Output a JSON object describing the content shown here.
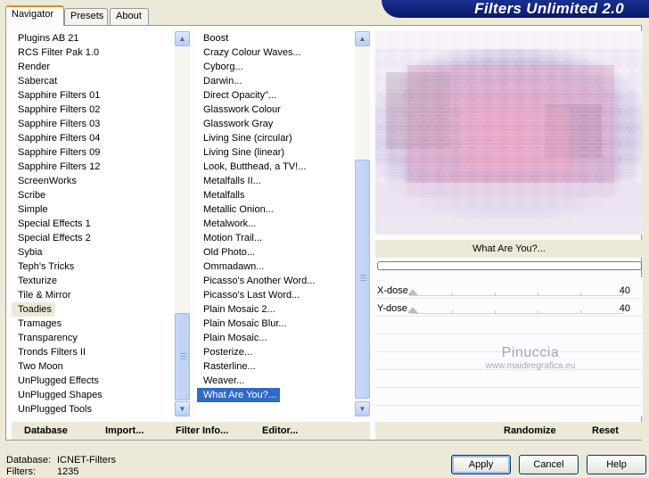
{
  "tabs": [
    "Navigator",
    "Presets",
    "About"
  ],
  "app_title": "Filters Unlimited 2.0",
  "categories": {
    "items": [
      "Plugins AB 21",
      "RCS Filter Pak 1.0",
      "Render",
      "Sabercat",
      "Sapphire Filters 01",
      "Sapphire Filters 02",
      "Sapphire Filters 03",
      "Sapphire Filters 04",
      "Sapphire Filters 09",
      "Sapphire Filters 12",
      "ScreenWorks",
      "Scribe",
      "Simple",
      "Special Effects 1",
      "Special Effects 2",
      "Sybia",
      "Teph's Tricks",
      "Texturize",
      "Tile & Mirror",
      "Toadies",
      "Tramages",
      "Transparency",
      "Tronds Filters II",
      "Two Moon",
      "UnPlugged Effects",
      "UnPlugged Shapes",
      "UnPlugged Tools"
    ],
    "selected": "Toadies"
  },
  "filters": {
    "items": [
      "Boost",
      "Crazy Colour Waves...",
      "Cyborg...",
      "Darwin...",
      "Direct Opacity\"...",
      "Glasswork Colour",
      "Glasswork Gray",
      "Living Sine (circular)",
      "Living Sine (linear)",
      "Look, Butthead, a TV!...",
      "Metalfalls II...",
      "Metalfalls",
      "Metallic Onion...",
      "Metalwork...",
      "Motion Trail...",
      "Old Photo...",
      "Ommadawn...",
      "Picasso's Another Word...",
      "Picasso's Last Word...",
      "Plain Mosaic 2...",
      "Plain Mosaic Blur...",
      "Plain Mosaic...",
      "Posterize...",
      "Rasterline...",
      "Weaver...",
      "What Are You?..."
    ],
    "selected": "What Are You?..."
  },
  "filter_name": "What Are You?...",
  "params": [
    {
      "label": "X-dose",
      "value": "40",
      "level": 0
    },
    {
      "label": "Y-dose",
      "value": "40",
      "level": 0
    }
  ],
  "watermark": {
    "line1": "Pinuccia",
    "line2": "www.maidiregrafica.eu"
  },
  "buttons": {
    "database": "Database",
    "import": "Import...",
    "filter_info": "Filter Info...",
    "editor": "Editor...",
    "randomize": "Randomize",
    "reset": "Reset",
    "apply": "Apply",
    "cancel": "Cancel",
    "help": "Help"
  },
  "status": {
    "database_label": "Database:",
    "database_value": "ICNET-Filters",
    "filters_label": "Filters:",
    "filters_value": "1235"
  },
  "colors": {
    "selection": "#316ac5",
    "banner": "#0a1a6a",
    "panel_bg": "#ece9d8",
    "tab_accent": "#e68b2c"
  }
}
